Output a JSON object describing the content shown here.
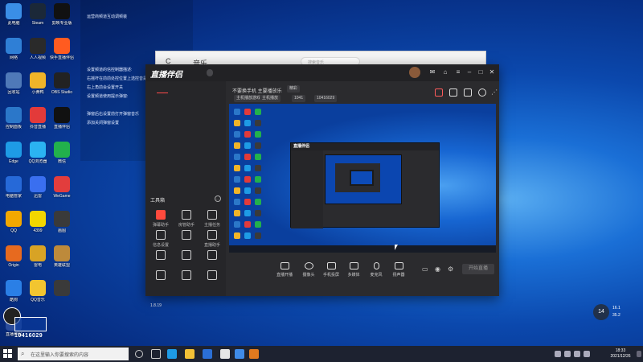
{
  "notepad_lines": [
    "运营商频道互动调频装",
    "",
    "",
    "",
    "",
    "",
    "设置频道的信控制器描述:",
    "右摇杆在前前处控位置上选控音是前驱左上",
    "右上角前会设置开关",
    "设置频道使用提示弹窗:",
    "",
    "弹窗后右设置前打开弹窗音乐",
    "添加关闭弹窗设置"
  ],
  "desktop_icons": [
    {
      "label": "此电脑",
      "color": "#3a8ee6"
    },
    {
      "label": "Steam",
      "color": "#1b2838"
    },
    {
      "label": "剪映专业版",
      "color": "#111111"
    },
    {
      "label": "网络",
      "color": "#2f7fd6"
    },
    {
      "label": "人人视频",
      "color": "#2a2a2a"
    },
    {
      "label": "快手直播伴侣",
      "color": "#ff5b20"
    },
    {
      "label": "回收站",
      "color": "#4f79b8"
    },
    {
      "label": "小黄鸭",
      "color": "#f0b429"
    },
    {
      "label": "OBS Studio",
      "color": "#222222"
    },
    {
      "label": "控制面板",
      "color": "#2b77c9"
    },
    {
      "label": "抖音直播",
      "color": "#e33a3a"
    },
    {
      "label": "直播伴侣",
      "color": "#111111"
    },
    {
      "label": "Edge",
      "color": "#1e9be6"
    },
    {
      "label": "QQ浏览器",
      "color": "#2bb3f2"
    },
    {
      "label": "微信",
      "color": "#22b14c"
    },
    {
      "label": "电脑管家",
      "color": "#2669d8"
    },
    {
      "label": "迅雷",
      "color": "#3a6ff0"
    },
    {
      "label": "WeGame",
      "color": "#e23d3d"
    },
    {
      "label": "QQ",
      "color": "#f2a800"
    },
    {
      "label": "4399",
      "color": "#f2d600"
    },
    {
      "label": "画图",
      "color": "#3a3a3a"
    },
    {
      "label": "Origin",
      "color": "#e76a1f"
    },
    {
      "label": "雷电",
      "color": "#d8a325"
    },
    {
      "label": "英雄联盟",
      "color": "#bd8a3b"
    },
    {
      "label": "酷狗",
      "color": "#2a7fe6"
    },
    {
      "label": "QQ音乐",
      "color": "#f2c530"
    },
    {
      "label": "",
      "color": "#3a3a3a"
    },
    {
      "label": "直播伴侣",
      "color": "#2a4c9b"
    }
  ],
  "music_window": {
    "items": [
      "C",
      "音乐",
      "",
      "",
      ""
    ],
    "search_placeholder": "搜索音乐"
  },
  "app": {
    "brand": "直播伴侣",
    "version": "",
    "left_tabs": [
      "",
      "",
      ""
    ],
    "tools_header": "工具箱",
    "tools": [
      "弹幕助手",
      "房管助手",
      "主播任务",
      "信息设置",
      "",
      "直播助手",
      "",
      "",
      "",
      "",
      "",
      ""
    ],
    "left_bottom_text": "1.8.19",
    "top_title": "不要换手机 主要播放乐",
    "top_chip": "精彩",
    "chips": [
      "主机播放游戏",
      "主机播放",
      "1041",
      "10416029"
    ],
    "bottom_buttons": [
      "直播开播",
      "摄像头",
      "手机投屏",
      "多媒体",
      "麦克风",
      "扬声器"
    ],
    "live_button": "开始直播",
    "nested_brand": "直播伴侣"
  },
  "watermark": {
    "number": "10416029"
  },
  "weather": {
    "temp": "14",
    "line1": "16.1",
    "line2": "35.2"
  },
  "taskbar": {
    "search_placeholder": "在这里输入你要搜索的内容",
    "time": "18:33",
    "date": "2021/12/26"
  }
}
